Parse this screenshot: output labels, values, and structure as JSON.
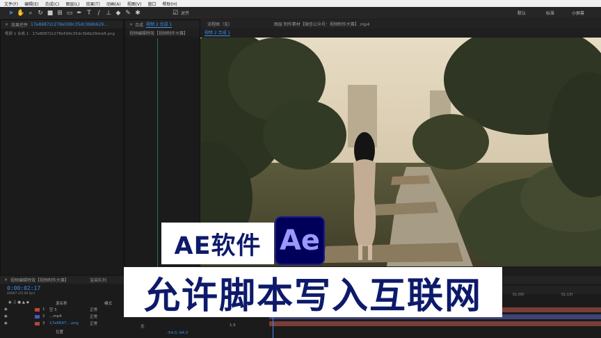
{
  "menu": [
    "文件(F)",
    "编辑(E)",
    "合成(C)",
    "图层(L)",
    "效果(T)",
    "动画(A)",
    "视图(V)",
    "窗口",
    "帮助(H)"
  ],
  "toolbar": {
    "snap_label": "对齐",
    "workspaces": [
      "默认",
      "标准",
      "小屏幕"
    ]
  },
  "left_panel": {
    "tab": "效果控件",
    "tab_file": "17e86872c278e599c35dc3b6b629...",
    "subtitle": "视频 1 合成 1 · 17e86872c278e599c35dc3b6b29dcb8.png"
  },
  "center": {
    "tabs": [
      "合成",
      "视频 2 合成 1"
    ],
    "subtabs": [
      "视频编辑特效【视频制作大赛】",
      "视频 2 合成 1"
    ],
    "flow_label": "流程图（无）",
    "layer_tab": "图层 制作素材【微信公众号：视频制作大赛】.mp4"
  },
  "overlay": {
    "line1": "AE软件",
    "logo": "Ae",
    "line2": "允许脚本写入互联网"
  },
  "timeline": {
    "tab": "视频编辑特效【视频制作大赛】",
    "render_tab": "渲染队列",
    "timecode": "0:00:02:17",
    "frames": "00067 (25.00 fps)",
    "col_name": "源名称",
    "col_mode": "模式",
    "rows": [
      {
        "num": "1",
        "name": "空 5",
        "mode": "正常",
        "color": "#c4413b"
      },
      {
        "num": "2",
        "name": "...mp4",
        "mode": "正常",
        "color": "#4a55c7"
      },
      {
        "num": "3",
        "name": "17e8697....png",
        "mode": "正常",
        "color": "#b8433d"
      }
    ],
    "property": "位置",
    "prop_value": "-54.0,-94.0",
    "mode_none": "无",
    "stretch": "1.5",
    "ruler": [
      "00s",
      "00:15f",
      "01:00f",
      "01:15f"
    ]
  }
}
